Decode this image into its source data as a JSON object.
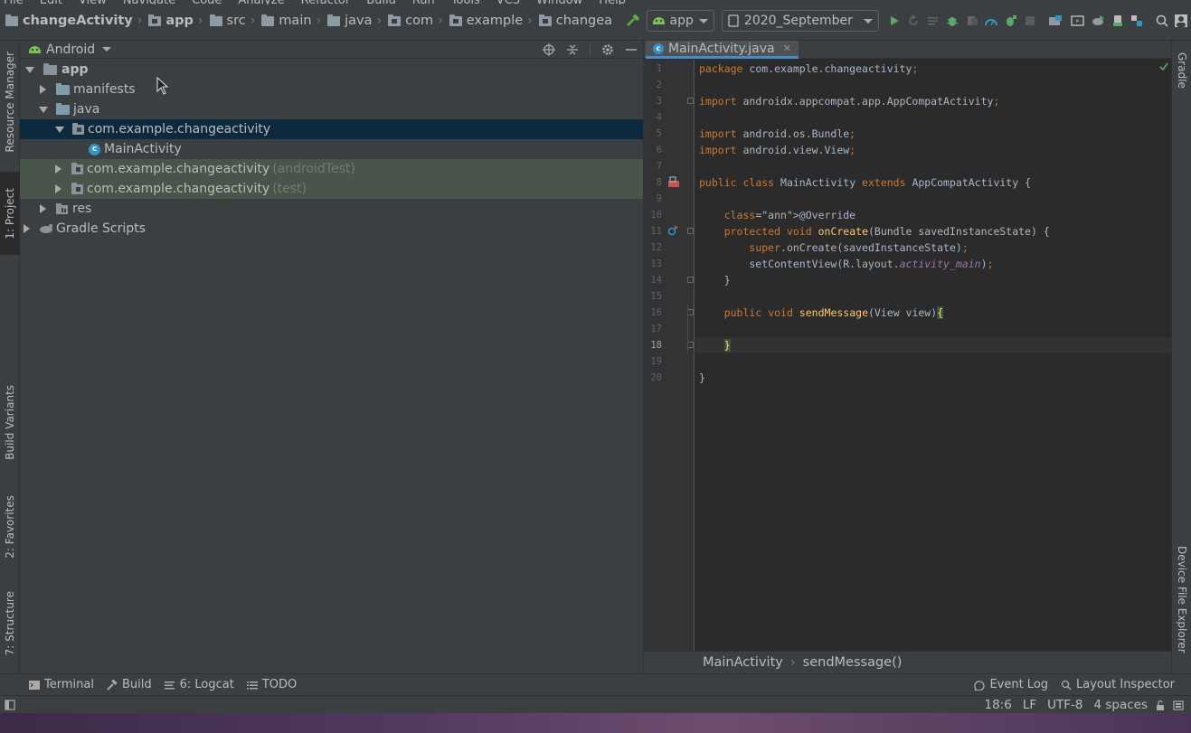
{
  "menu": {
    "items": [
      "File",
      "Edit",
      "View",
      "Navigate",
      "Code",
      "Analyze",
      "Refactor",
      "Build",
      "Run",
      "Tools",
      "VCS",
      "Window",
      "Help"
    ]
  },
  "breadcrumb": {
    "items": [
      "changeActivity",
      "app",
      "src",
      "main",
      "java",
      "com",
      "example",
      "changea"
    ]
  },
  "toolbar": {
    "run_config": "app",
    "branch": "2020_September"
  },
  "project_panel": {
    "view_mode": "Android",
    "tree": [
      {
        "label": "app",
        "suffix": "",
        "level": 0,
        "expanded": true,
        "icon": "folder-module-icon"
      },
      {
        "label": "manifests",
        "suffix": "",
        "level": 1,
        "expanded": false,
        "icon": "folder-icon"
      },
      {
        "label": "java",
        "suffix": "",
        "level": 1,
        "expanded": true,
        "icon": "folder-icon"
      },
      {
        "label": "com.example.changeactivity",
        "suffix": "",
        "level": 2,
        "expanded": true,
        "icon": "package-icon"
      },
      {
        "label": "MainActivity",
        "suffix": "",
        "level": 3,
        "expanded": null,
        "icon": "class-icon"
      },
      {
        "label": "com.example.changeactivity",
        "suffix": "(androidTest)",
        "level": 2,
        "expanded": false,
        "icon": "package-icon"
      },
      {
        "label": "com.example.changeactivity",
        "suffix": "(test)",
        "level": 2,
        "expanded": false,
        "icon": "package-icon"
      },
      {
        "label": "res",
        "suffix": "",
        "level": 1,
        "expanded": false,
        "icon": "res-folder-icon"
      },
      {
        "label": "Gradle Scripts",
        "suffix": "",
        "level": 0,
        "expanded": false,
        "icon": "gradle-icon"
      }
    ]
  },
  "left_stripe": {
    "resource_manager": "Resource Manager",
    "project": "1: Project",
    "build_variants": "Build Variants",
    "favorites": "2: Favorites",
    "structure": "7: Structure"
  },
  "right_stripe": {
    "gradle": "Gradle",
    "device_file_explorer": "Device File Explorer"
  },
  "editor": {
    "tab_label": "MainActivity.java",
    "line_numbers": [
      "1",
      "2",
      "3",
      "4",
      "5",
      "6",
      "7",
      "8",
      "9",
      "10",
      "11",
      "12",
      "13",
      "14",
      "15",
      "16",
      "17",
      "18",
      "19",
      "20"
    ],
    "current_line": 18,
    "code_lines": [
      "package com.example.changeactivity;",
      "",
      "import androidx.appcompat.app.AppCompatActivity;",
      "",
      "import android.os.Bundle;",
      "import android.view.View;",
      "",
      "public class MainActivity extends AppCompatActivity {",
      "",
      "    @Override",
      "    protected void onCreate(Bundle savedInstanceState) {",
      "        super.onCreate(savedInstanceState);",
      "        setContentView(R.layout.activity_main);",
      "    }",
      "",
      "    public void sendMessage(View view){",
      "",
      "    }",
      "",
      "}"
    ],
    "breadcrumb": [
      "MainActivity",
      "sendMessage()"
    ]
  },
  "bottom_tools": {
    "terminal": "Terminal",
    "build": "Build",
    "logcat": "6: Logcat",
    "todo": "TODO",
    "event_log": "Event Log",
    "layout_inspector": "Layout Inspector"
  },
  "status": {
    "position": "18:6",
    "line_sep": "LF",
    "encoding": "UTF-8",
    "indent": "4 spaces"
  },
  "colors": {
    "keyword": "#cc7832",
    "method": "#ffc66d",
    "annotation": "#bbb529",
    "field": "#9876aa",
    "selection": "#0d293e",
    "test_highlight": "#49544a"
  }
}
